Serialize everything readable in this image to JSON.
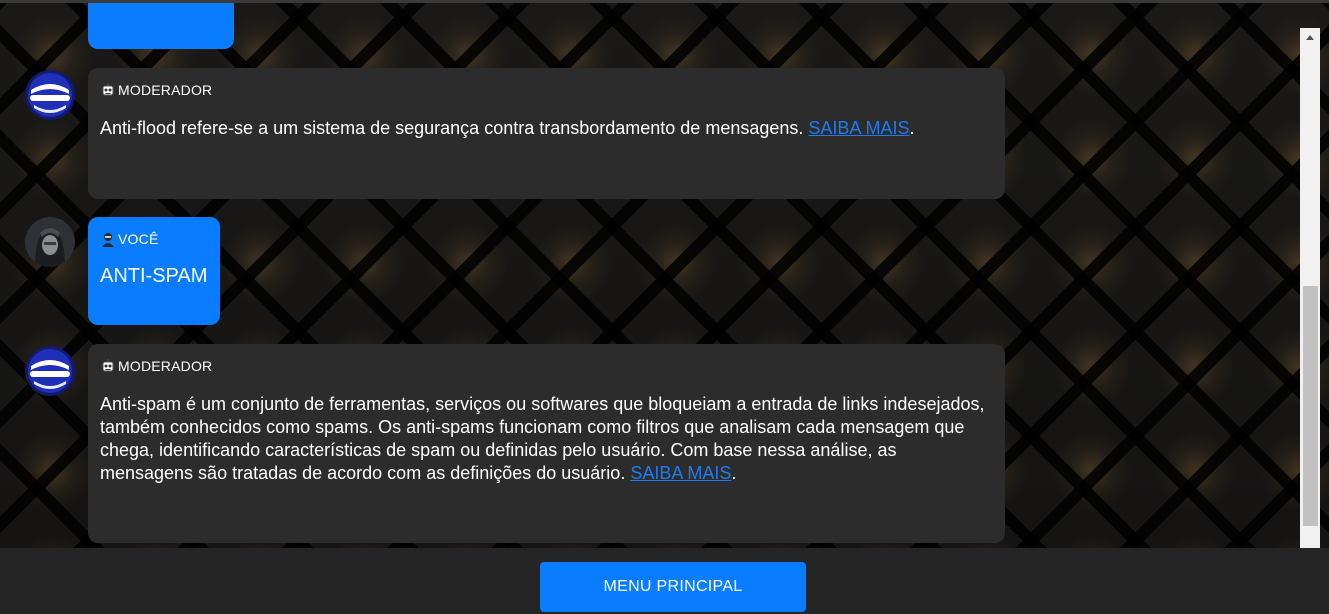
{
  "messages": [
    {
      "role": "user",
      "text": ""
    },
    {
      "role": "moderator",
      "sender": "MODERADOR",
      "text": "Anti-flood refere-se a um sistema de segurança contra transbordamento de mensagens.",
      "link_text": "SAIBA MAIS",
      "suffix": "."
    },
    {
      "role": "user",
      "sender": "VOCÊ",
      "text": "ANTI-SPAM"
    },
    {
      "role": "moderator",
      "sender": "MODERADOR",
      "text": "Anti-spam é um conjunto de ferramentas, serviços ou softwares que bloqueiam a entrada de links indesejados, também conhecidos como spams. Os anti-spams funcionam como filtros que analisam cada mensagem que chega, identificando características de spam ou definidas pelo usuário. Com base nessa análise, as mensagens são tratadas de acordo com as definições do usuário.",
      "link_text": "SAIBA MAIS",
      "suffix": "."
    }
  ],
  "footer": {
    "menu_button_label": "MENU PRINCIPAL"
  },
  "icons": {
    "moderator_avatar": "moderator-avatar",
    "user_avatar": "hooded-user-avatar",
    "moderator_sender_icon": "robot-icon",
    "user_sender_icon": "hacker-icon",
    "scroll_up": "scroll-up-arrow-icon"
  },
  "colors": {
    "user_bubble": "#0a7cff",
    "moderator_bubble": "#2c2c2c",
    "link": "#1e7bf4",
    "button": "#0a7cff",
    "footer": "#252525"
  }
}
